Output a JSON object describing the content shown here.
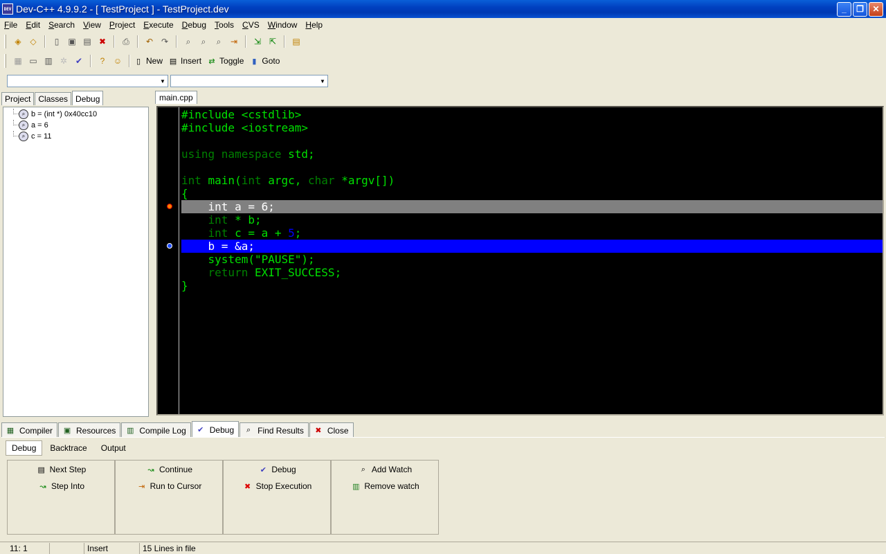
{
  "window": {
    "title": "Dev-C++ 4.9.9.2  -  [ TestProject ] - TestProject.dev",
    "icon_text": "DEV"
  },
  "menu": [
    "File",
    "Edit",
    "Search",
    "View",
    "Project",
    "Execute",
    "Debug",
    "Tools",
    "CVS",
    "Window",
    "Help"
  ],
  "toolbar2": {
    "new_label": "New",
    "insert_label": "Insert",
    "toggle_label": "Toggle",
    "goto_label": "Goto"
  },
  "left_tabs": [
    "Project",
    "Classes",
    "Debug"
  ],
  "watches": [
    {
      "label": "b = (int *) 0x40cc10"
    },
    {
      "label": "a = 6"
    },
    {
      "label": "c = 11"
    }
  ],
  "editor": {
    "tab_label": "main.cpp",
    "lines": [
      {
        "segments": [
          {
            "c": "grn",
            "t": "#include <cstdlib>"
          }
        ]
      },
      {
        "segments": [
          {
            "c": "grn",
            "t": "#include <iostream>"
          }
        ]
      },
      {
        "segments": []
      },
      {
        "segments": [
          {
            "c": "kw-type",
            "t": "using namespace "
          },
          {
            "c": "grn",
            "t": "std;"
          }
        ]
      },
      {
        "segments": []
      },
      {
        "segments": [
          {
            "c": "kw-type",
            "t": "int "
          },
          {
            "c": "grn",
            "t": "main("
          },
          {
            "c": "kw-type",
            "t": "int "
          },
          {
            "c": "grn",
            "t": "argc, "
          },
          {
            "c": "kw-type",
            "t": "char "
          },
          {
            "c": "grn",
            "t": "*argv[])"
          }
        ]
      },
      {
        "segments": [
          {
            "c": "grn",
            "t": "{"
          }
        ]
      },
      {
        "segments": [
          {
            "c": "wht",
            "t": "    int a = 6;"
          }
        ],
        "hl": "gray",
        "marker": "bp"
      },
      {
        "segments": [
          {
            "c": "kw-type",
            "t": "    int "
          },
          {
            "c": "grn",
            "t": "* b;"
          }
        ]
      },
      {
        "segments": [
          {
            "c": "kw-type",
            "t": "    int "
          },
          {
            "c": "grn",
            "t": "c = a + "
          },
          {
            "c": "blu",
            "t": "5"
          },
          {
            "c": "grn",
            "t": ";"
          }
        ]
      },
      {
        "segments": [
          {
            "c": "wht",
            "t": "    b = &a;"
          }
        ],
        "hl": "blue",
        "marker": "cur"
      },
      {
        "segments": [
          {
            "c": "grn",
            "t": "    system(\"PAUSE\");"
          }
        ]
      },
      {
        "segments": [
          {
            "c": "kw-type",
            "t": "    return "
          },
          {
            "c": "grn",
            "t": "EXIT_SUCCESS;"
          }
        ]
      },
      {
        "segments": [
          {
            "c": "grn",
            "t": "}"
          }
        ]
      }
    ]
  },
  "bottom_tabs": [
    "Compiler",
    "Resources",
    "Compile Log",
    "Debug",
    "Find Results",
    "Close"
  ],
  "sub_tabs": [
    "Debug",
    "Backtrace",
    "Output"
  ],
  "debug_buttons": {
    "next_step": "Next Step",
    "step_into": "Step Into",
    "continue": "Continue",
    "run_to_cursor": "Run to Cursor",
    "debug": "Debug",
    "stop_execution": "Stop Execution",
    "add_watch": "Add Watch",
    "remove_watch": "Remove watch"
  },
  "status": {
    "position": "11: 1",
    "modified": "",
    "mode": "Insert",
    "lines": "15 Lines in file"
  }
}
